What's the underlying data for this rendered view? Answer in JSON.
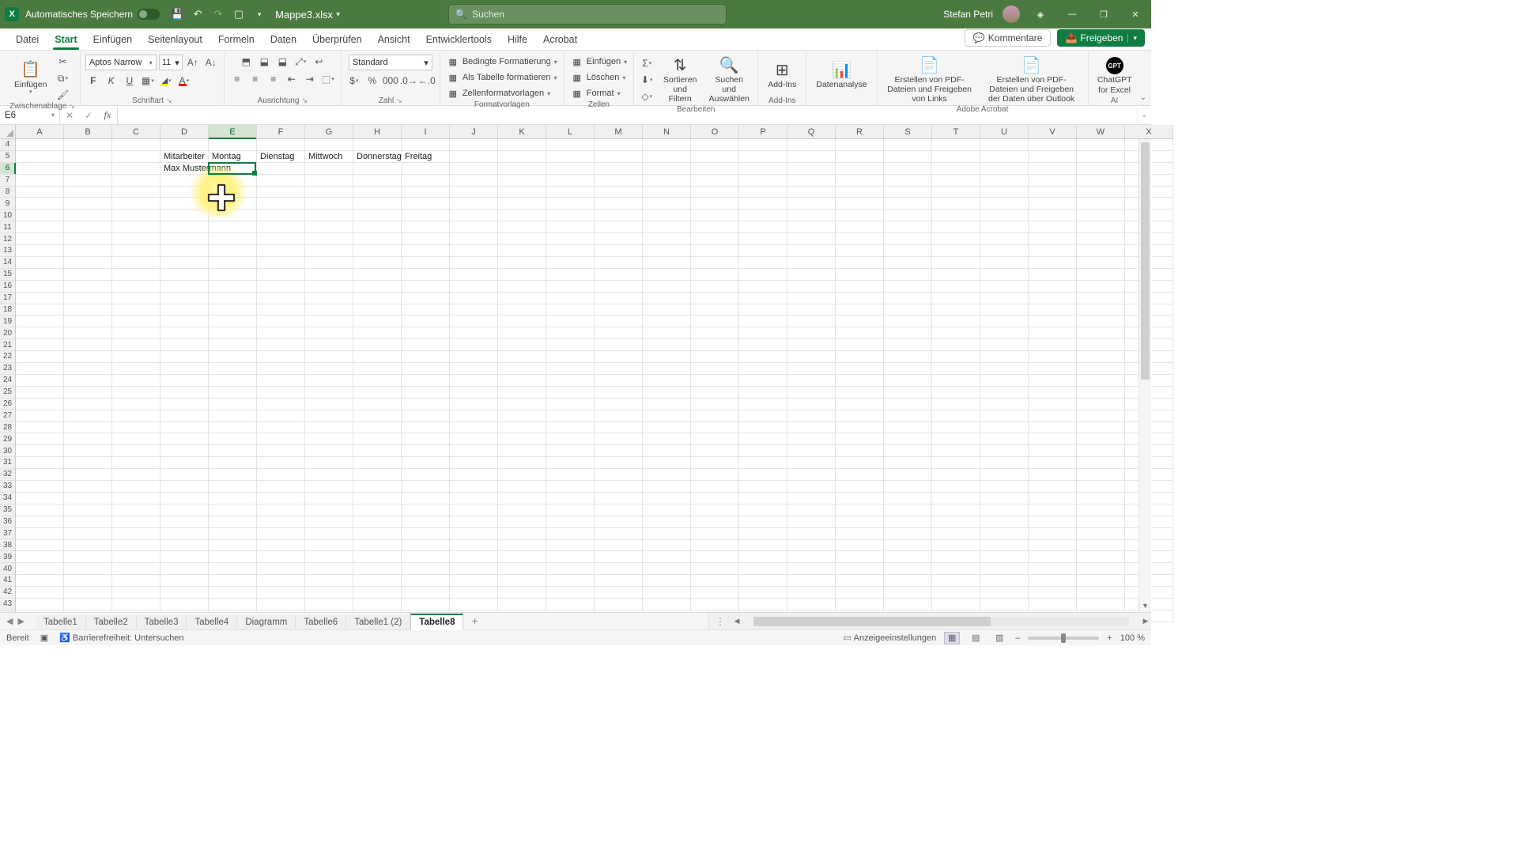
{
  "title": {
    "autosave_label": "Automatisches Speichern",
    "filename": "Mappe3.xlsx",
    "username": "Stefan Petri",
    "search_placeholder": "Suchen"
  },
  "menu": {
    "tabs": [
      "Datei",
      "Start",
      "Einfügen",
      "Seitenlayout",
      "Formeln",
      "Daten",
      "Überprüfen",
      "Ansicht",
      "Entwicklertools",
      "Hilfe",
      "Acrobat"
    ],
    "active": 1,
    "comments": "Kommentare",
    "share": "Freigeben"
  },
  "ribbon": {
    "clipboard": {
      "paste": "Einfügen",
      "label": "Zwischenablage"
    },
    "font": {
      "name": "Aptos Narrow",
      "size": "11",
      "label": "Schriftart"
    },
    "align": {
      "label": "Ausrichtung"
    },
    "number": {
      "format": "Standard",
      "label": "Zahl"
    },
    "styles": {
      "cond": "Bedingte Formatierung",
      "table": "Als Tabelle formatieren",
      "cell": "Zellenformatvorlagen",
      "label": "Formatvorlagen"
    },
    "cells": {
      "insert": "Einfügen",
      "delete": "Löschen",
      "format": "Format",
      "label": "Zellen"
    },
    "editing": {
      "sort": "Sortieren und Filtern",
      "find": "Suchen und Auswählen",
      "label": "Bearbeiten"
    },
    "addins": {
      "btn": "Add-Ins",
      "label": "Add-Ins"
    },
    "analysis": {
      "btn": "Datenanalyse"
    },
    "acrobat": {
      "pdf1": "Erstellen von PDF-Dateien und Freigeben von Links",
      "pdf2": "Erstellen von PDF-Dateien und Freigeben der Daten über Outlook",
      "label": "Adobe Acrobat"
    },
    "ai": {
      "btn": "ChatGPT for Excel",
      "label": "AI"
    }
  },
  "formula": {
    "cellref": "E6",
    "value": ""
  },
  "columns": [
    "A",
    "B",
    "C",
    "D",
    "E",
    "F",
    "G",
    "H",
    "I",
    "J",
    "K",
    "L",
    "M",
    "N",
    "O",
    "P",
    "Q",
    "R",
    "S",
    "T",
    "U",
    "V",
    "W",
    "X"
  ],
  "sel_col_index": 4,
  "first_row": 4,
  "sel_row": 6,
  "cells": {
    "D5": "Mitarbeiter",
    "E5": "Montag",
    "F5": "Dienstag",
    "G5": "Mittwoch",
    "H5": "Donnerstag",
    "I5": "Freitag",
    "D6": "Max Mustermann"
  },
  "sheets": {
    "tabs": [
      "Tabelle1",
      "Tabelle2",
      "Tabelle3",
      "Tabelle4",
      "Diagramm",
      "Tabelle6",
      "Tabelle1 (2)",
      "Tabelle8"
    ],
    "active": 7
  },
  "status": {
    "ready": "Bereit",
    "access": "Barrierefreiheit: Untersuchen",
    "display": "Anzeigeeinstellungen",
    "zoom": "100 %"
  }
}
